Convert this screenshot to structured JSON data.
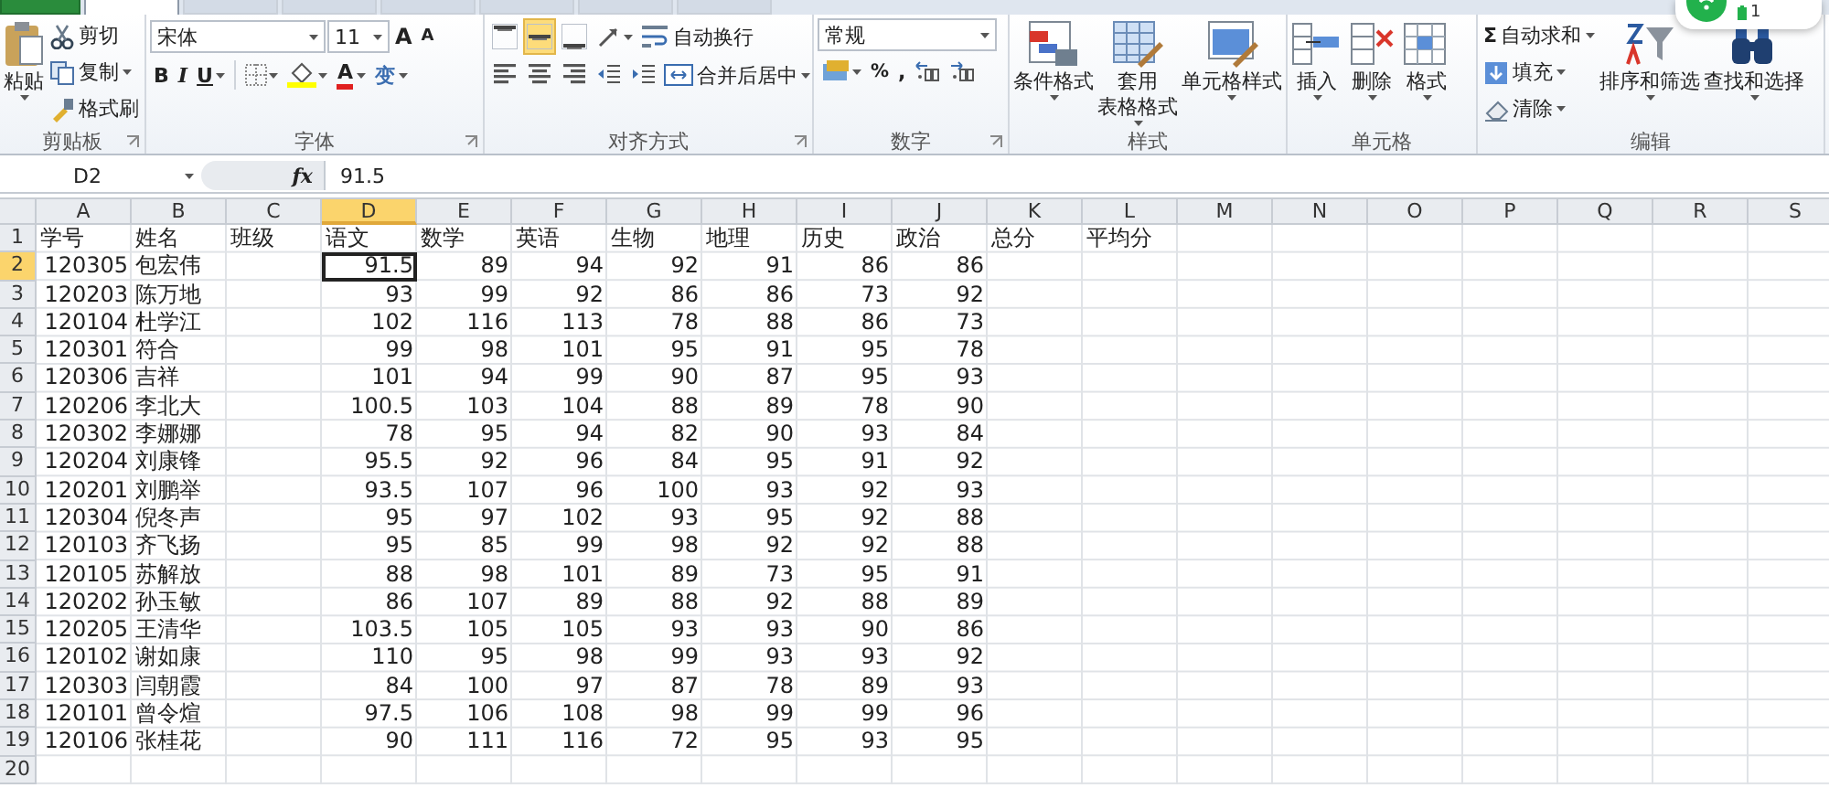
{
  "tabs": [
    {
      "kind": "file",
      "selected": false
    },
    {
      "kind": "tab",
      "selected": true
    },
    {
      "kind": "tab",
      "selected": false
    },
    {
      "kind": "tab",
      "selected": false
    },
    {
      "kind": "tab",
      "selected": false
    },
    {
      "kind": "tab",
      "selected": false
    },
    {
      "kind": "tab",
      "selected": false
    },
    {
      "kind": "tab",
      "selected": false
    }
  ],
  "ribbon": {
    "groups": [
      {
        "kind": "clipboard",
        "label": "剪贴板",
        "paste": "粘贴",
        "items": [
          "剪切",
          "复制",
          "格式刷"
        ]
      },
      {
        "kind": "font",
        "label": "字体",
        "font_name": "宋体",
        "font_size": "11",
        "grow": "A",
        "shrink": "A",
        "styles": [
          "B",
          "I",
          "U"
        ],
        "font_color": "A",
        "phonetic": "变"
      },
      {
        "kind": "alignment",
        "label": "对齐方式",
        "vertical": [
          {
            "selected": false
          },
          {
            "selected": true
          },
          {
            "selected": false
          }
        ],
        "wrap": "自动换行",
        "merge": "合并后居中"
      },
      {
        "kind": "number",
        "label": "数字",
        "format": "常规",
        "percent": "%",
        "comma": ","
      },
      {
        "kind": "styles",
        "label": "样式",
        "buttons": [
          {
            "lines": [
              "条件格式"
            ]
          },
          {
            "lines": [
              "套用",
              "表格格式"
            ]
          },
          {
            "lines": [
              "单元格样式"
            ]
          }
        ]
      },
      {
        "kind": "cells",
        "label": "单元格",
        "buttons": [
          "插入",
          "删除",
          "格式"
        ]
      },
      {
        "kind": "editing",
        "label": "编辑",
        "sum_symbol": "Σ",
        "items": [
          "自动求和",
          "填充",
          "清除"
        ],
        "buttons": [
          "排序和筛选",
          "查找和选择"
        ]
      }
    ]
  },
  "formula_bar": {
    "name_box": "D2",
    "fx": "fx",
    "value": "91.5"
  },
  "sheet": {
    "columns": [
      {
        "letter": "A",
        "selected": false
      },
      {
        "letter": "B",
        "selected": false
      },
      {
        "letter": "C",
        "selected": false
      },
      {
        "letter": "D",
        "selected": true
      },
      {
        "letter": "E",
        "selected": false
      },
      {
        "letter": "F",
        "selected": false
      },
      {
        "letter": "G",
        "selected": false
      },
      {
        "letter": "H",
        "selected": false
      },
      {
        "letter": "I",
        "selected": false
      },
      {
        "letter": "J",
        "selected": false
      },
      {
        "letter": "K",
        "selected": false
      },
      {
        "letter": "L",
        "selected": false
      },
      {
        "letter": "M",
        "selected": false
      },
      {
        "letter": "N",
        "selected": false
      },
      {
        "letter": "O",
        "selected": false
      },
      {
        "letter": "P",
        "selected": false
      },
      {
        "letter": "Q",
        "selected": false
      },
      {
        "letter": "R",
        "selected": false
      },
      {
        "letter": "S",
        "selected": false
      }
    ],
    "row_numbers": [
      {
        "label": "1",
        "selected": false
      },
      {
        "label": "2",
        "selected": true
      },
      {
        "label": "3",
        "selected": false
      },
      {
        "label": "4",
        "selected": false
      },
      {
        "label": "5",
        "selected": false
      },
      {
        "label": "6",
        "selected": false
      },
      {
        "label": "7",
        "selected": false
      },
      {
        "label": "8",
        "selected": false
      },
      {
        "label": "9",
        "selected": false
      },
      {
        "label": "10",
        "selected": false
      },
      {
        "label": "11",
        "selected": false
      },
      {
        "label": "12",
        "selected": false
      },
      {
        "label": "13",
        "selected": false
      },
      {
        "label": "14",
        "selected": false
      },
      {
        "label": "15",
        "selected": false
      },
      {
        "label": "16",
        "selected": false
      },
      {
        "label": "17",
        "selected": false
      },
      {
        "label": "18",
        "selected": false
      },
      {
        "label": "19",
        "selected": false
      },
      {
        "label": "20",
        "selected": false
      }
    ],
    "header_row": [
      "学号",
      "姓名",
      "班级",
      "语文",
      "数学",
      "英语",
      "生物",
      "地理",
      "历史",
      "政治",
      "总分",
      "平均分"
    ],
    "rows": [
      {
        "id": "120305",
        "name": "包宏伟",
        "scores": [
          {
            "value": "91.5",
            "selected": true
          },
          {
            "value": "89",
            "selected": false
          },
          {
            "value": "94",
            "selected": false
          },
          {
            "value": "92",
            "selected": false
          },
          {
            "value": "91",
            "selected": false
          },
          {
            "value": "86",
            "selected": false
          },
          {
            "value": "86",
            "selected": false
          }
        ]
      },
      {
        "id": "120203",
        "name": "陈万地",
        "scores": [
          {
            "value": "93",
            "selected": false
          },
          {
            "value": "99",
            "selected": false
          },
          {
            "value": "92",
            "selected": false
          },
          {
            "value": "86",
            "selected": false
          },
          {
            "value": "86",
            "selected": false
          },
          {
            "value": "73",
            "selected": false
          },
          {
            "value": "92",
            "selected": false
          }
        ]
      },
      {
        "id": "120104",
        "name": "杜学江",
        "scores": [
          {
            "value": "102",
            "selected": false
          },
          {
            "value": "116",
            "selected": false
          },
          {
            "value": "113",
            "selected": false
          },
          {
            "value": "78",
            "selected": false
          },
          {
            "value": "88",
            "selected": false
          },
          {
            "value": "86",
            "selected": false
          },
          {
            "value": "73",
            "selected": false
          }
        ]
      },
      {
        "id": "120301",
        "name": "符合",
        "scores": [
          {
            "value": "99",
            "selected": false
          },
          {
            "value": "98",
            "selected": false
          },
          {
            "value": "101",
            "selected": false
          },
          {
            "value": "95",
            "selected": false
          },
          {
            "value": "91",
            "selected": false
          },
          {
            "value": "95",
            "selected": false
          },
          {
            "value": "78",
            "selected": false
          }
        ]
      },
      {
        "id": "120306",
        "name": "吉祥",
        "scores": [
          {
            "value": "101",
            "selected": false
          },
          {
            "value": "94",
            "selected": false
          },
          {
            "value": "99",
            "selected": false
          },
          {
            "value": "90",
            "selected": false
          },
          {
            "value": "87",
            "selected": false
          },
          {
            "value": "95",
            "selected": false
          },
          {
            "value": "93",
            "selected": false
          }
        ]
      },
      {
        "id": "120206",
        "name": "李北大",
        "scores": [
          {
            "value": "100.5",
            "selected": false
          },
          {
            "value": "103",
            "selected": false
          },
          {
            "value": "104",
            "selected": false
          },
          {
            "value": "88",
            "selected": false
          },
          {
            "value": "89",
            "selected": false
          },
          {
            "value": "78",
            "selected": false
          },
          {
            "value": "90",
            "selected": false
          }
        ]
      },
      {
        "id": "120302",
        "name": "李娜娜",
        "scores": [
          {
            "value": "78",
            "selected": false
          },
          {
            "value": "95",
            "selected": false
          },
          {
            "value": "94",
            "selected": false
          },
          {
            "value": "82",
            "selected": false
          },
          {
            "value": "90",
            "selected": false
          },
          {
            "value": "93",
            "selected": false
          },
          {
            "value": "84",
            "selected": false
          }
        ]
      },
      {
        "id": "120204",
        "name": "刘康锋",
        "scores": [
          {
            "value": "95.5",
            "selected": false
          },
          {
            "value": "92",
            "selected": false
          },
          {
            "value": "96",
            "selected": false
          },
          {
            "value": "84",
            "selected": false
          },
          {
            "value": "95",
            "selected": false
          },
          {
            "value": "91",
            "selected": false
          },
          {
            "value": "92",
            "selected": false
          }
        ]
      },
      {
        "id": "120201",
        "name": "刘鹏举",
        "scores": [
          {
            "value": "93.5",
            "selected": false
          },
          {
            "value": "107",
            "selected": false
          },
          {
            "value": "96",
            "selected": false
          },
          {
            "value": "100",
            "selected": false
          },
          {
            "value": "93",
            "selected": false
          },
          {
            "value": "92",
            "selected": false
          },
          {
            "value": "93",
            "selected": false
          }
        ]
      },
      {
        "id": "120304",
        "name": "倪冬声",
        "scores": [
          {
            "value": "95",
            "selected": false
          },
          {
            "value": "97",
            "selected": false
          },
          {
            "value": "102",
            "selected": false
          },
          {
            "value": "93",
            "selected": false
          },
          {
            "value": "95",
            "selected": false
          },
          {
            "value": "92",
            "selected": false
          },
          {
            "value": "88",
            "selected": false
          }
        ]
      },
      {
        "id": "120103",
        "name": "齐飞扬",
        "scores": [
          {
            "value": "95",
            "selected": false
          },
          {
            "value": "85",
            "selected": false
          },
          {
            "value": "99",
            "selected": false
          },
          {
            "value": "98",
            "selected": false
          },
          {
            "value": "92",
            "selected": false
          },
          {
            "value": "92",
            "selected": false
          },
          {
            "value": "88",
            "selected": false
          }
        ]
      },
      {
        "id": "120105",
        "name": "苏解放",
        "scores": [
          {
            "value": "88",
            "selected": false
          },
          {
            "value": "98",
            "selected": false
          },
          {
            "value": "101",
            "selected": false
          },
          {
            "value": "89",
            "selected": false
          },
          {
            "value": "73",
            "selected": false
          },
          {
            "value": "95",
            "selected": false
          },
          {
            "value": "91",
            "selected": false
          }
        ]
      },
      {
        "id": "120202",
        "name": "孙玉敏",
        "scores": [
          {
            "value": "86",
            "selected": false
          },
          {
            "value": "107",
            "selected": false
          },
          {
            "value": "89",
            "selected": false
          },
          {
            "value": "88",
            "selected": false
          },
          {
            "value": "92",
            "selected": false
          },
          {
            "value": "88",
            "selected": false
          },
          {
            "value": "89",
            "selected": false
          }
        ]
      },
      {
        "id": "120205",
        "name": "王清华",
        "scores": [
          {
            "value": "103.5",
            "selected": false
          },
          {
            "value": "105",
            "selected": false
          },
          {
            "value": "105",
            "selected": false
          },
          {
            "value": "93",
            "selected": false
          },
          {
            "value": "93",
            "selected": false
          },
          {
            "value": "90",
            "selected": false
          },
          {
            "value": "86",
            "selected": false
          }
        ]
      },
      {
        "id": "120102",
        "name": "谢如康",
        "scores": [
          {
            "value": "110",
            "selected": false
          },
          {
            "value": "95",
            "selected": false
          },
          {
            "value": "98",
            "selected": false
          },
          {
            "value": "99",
            "selected": false
          },
          {
            "value": "93",
            "selected": false
          },
          {
            "value": "93",
            "selected": false
          },
          {
            "value": "92",
            "selected": false
          }
        ]
      },
      {
        "id": "120303",
        "name": "闫朝霞",
        "scores": [
          {
            "value": "84",
            "selected": false
          },
          {
            "value": "100",
            "selected": false
          },
          {
            "value": "97",
            "selected": false
          },
          {
            "value": "87",
            "selected": false
          },
          {
            "value": "78",
            "selected": false
          },
          {
            "value": "89",
            "selected": false
          },
          {
            "value": "93",
            "selected": false
          }
        ]
      },
      {
        "id": "120101",
        "name": "曾令煊",
        "scores": [
          {
            "value": "97.5",
            "selected": false
          },
          {
            "value": "106",
            "selected": false
          },
          {
            "value": "108",
            "selected": false
          },
          {
            "value": "98",
            "selected": false
          },
          {
            "value": "99",
            "selected": false
          },
          {
            "value": "99",
            "selected": false
          },
          {
            "value": "96",
            "selected": false
          }
        ]
      },
      {
        "id": "120106",
        "name": "张桂花",
        "scores": [
          {
            "value": "90",
            "selected": false
          },
          {
            "value": "111",
            "selected": false
          },
          {
            "value": "116",
            "selected": false
          },
          {
            "value": "72",
            "selected": false
          },
          {
            "value": "95",
            "selected": false
          },
          {
            "value": "93",
            "selected": false
          },
          {
            "value": "95",
            "selected": false
          }
        ]
      }
    ]
  },
  "notification": {
    "count": "1"
  }
}
